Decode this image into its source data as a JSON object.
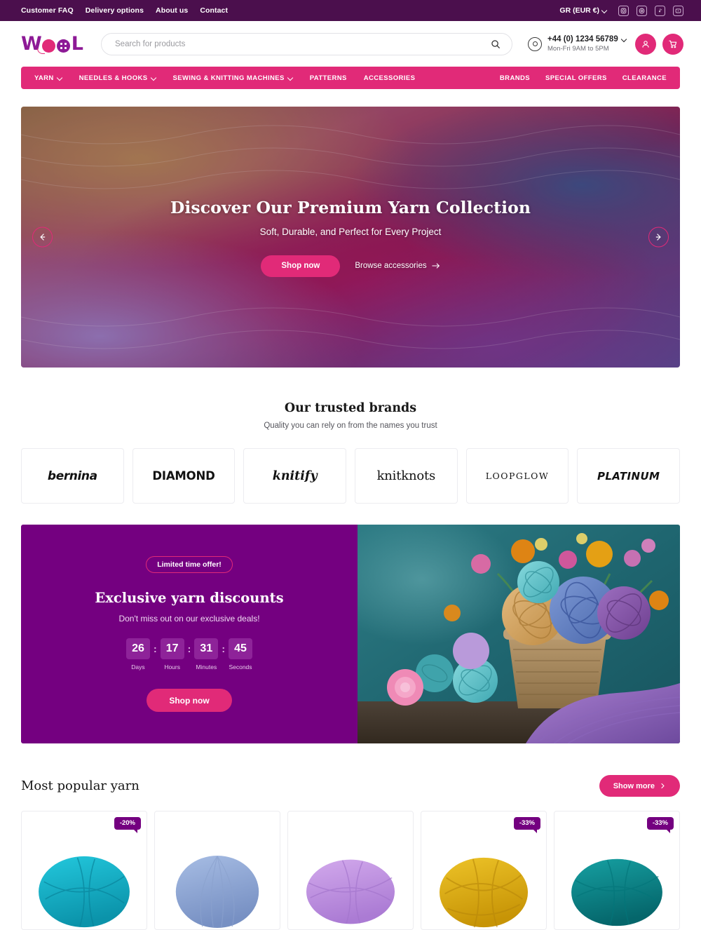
{
  "topbar": {
    "links": [
      {
        "label": "Customer FAQ"
      },
      {
        "label": "Delivery options"
      },
      {
        "label": "About us"
      },
      {
        "label": "Contact"
      }
    ],
    "currency": "GR (EUR €)",
    "socials": [
      {
        "name": "instagram-icon"
      },
      {
        "name": "pinterest-icon"
      },
      {
        "name": "tiktok-icon"
      },
      {
        "name": "youtube-icon"
      }
    ]
  },
  "header": {
    "logo": {
      "w": "W",
      "l": "L",
      "alt": "WOOL"
    },
    "search": {
      "value": "",
      "placeholder": "Search for products"
    },
    "phone": "+44 (0) 1234 56789",
    "hours": "Mon-Fri 9AM to 5PM",
    "account_label": "Account",
    "cart_label": "Cart"
  },
  "nav": {
    "left": [
      {
        "label": "YARN",
        "dropdown": true
      },
      {
        "label": "NEEDLES & HOOKS",
        "dropdown": true
      },
      {
        "label": "SEWING & KNITTING MACHINES",
        "dropdown": true
      },
      {
        "label": "PATTERNS",
        "dropdown": false
      },
      {
        "label": "ACCESSORIES",
        "dropdown": false
      }
    ],
    "right": [
      {
        "label": "BRANDS"
      },
      {
        "label": "SPECIAL OFFERS"
      },
      {
        "label": "CLEARANCE"
      }
    ]
  },
  "hero": {
    "title": "Discover Our Premium Yarn Collection",
    "subtitle": "Soft, Durable, and Perfect for Every Project",
    "primary_cta": "Shop now",
    "secondary_cta": "Browse accessories",
    "prev_label": "Previous slide",
    "next_label": "Next slide"
  },
  "brands": {
    "title": "Our trusted brands",
    "subtitle": "Quality you can rely on from the names you trust",
    "items": [
      {
        "name": "bernina"
      },
      {
        "name": "DIAMOND"
      },
      {
        "name": "knitify"
      },
      {
        "name": "knitknots"
      },
      {
        "name": "LOOPGLOW"
      },
      {
        "name": "PLATINUM"
      }
    ]
  },
  "promo": {
    "badge": "Limited time offer!",
    "title": "Exclusive yarn discounts",
    "subtitle": "Don't miss out on our exclusive deals!",
    "cta": "Shop now",
    "countdown": [
      {
        "value": "26",
        "label": "Days"
      },
      {
        "value": "17",
        "label": "Hours"
      },
      {
        "value": "31",
        "label": "Minutes"
      },
      {
        "value": "45",
        "label": "Seconds"
      }
    ],
    "separator": ":"
  },
  "products": {
    "title": "Most popular yarn",
    "show_more": "Show more",
    "items": [
      {
        "badge": "-20%",
        "color": "#17b6cc",
        "color2": "#0e93ab"
      },
      {
        "badge": "",
        "color": "#93abd6",
        "color2": "#7a93c4"
      },
      {
        "badge": "",
        "color": "#c49ae0",
        "color2": "#ae80d2"
      },
      {
        "badge": "-33%",
        "color": "#e0b019",
        "color2": "#c99708"
      },
      {
        "badge": "-33%",
        "color": "#0e8f91",
        "color2": "#077477"
      }
    ]
  },
  "colors": {
    "topbar_purple": "#4b0f4d",
    "brand_pink": "#e12a78",
    "promo_purple": "#740080",
    "logo_purple": "#8d1a96"
  }
}
